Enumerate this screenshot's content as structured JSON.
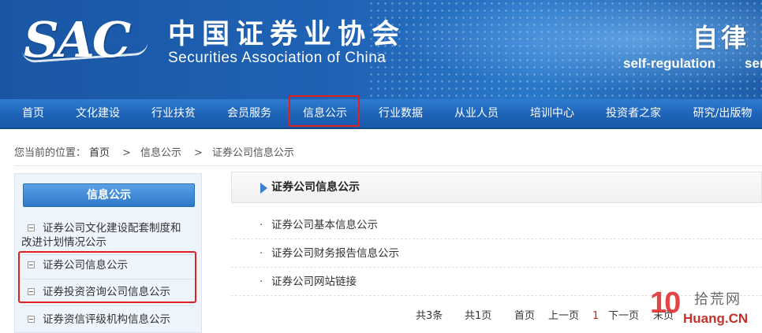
{
  "header": {
    "logo_text": "SAC",
    "org_name_cn": "中国证券业协会",
    "org_name_en": "Securities Association of China",
    "slogan_cn": "自律",
    "slogan_en": "self-regulation",
    "slogan_en_2": "ser"
  },
  "nav": {
    "items": [
      {
        "label": "首页"
      },
      {
        "label": "文化建设"
      },
      {
        "label": "行业扶贫"
      },
      {
        "label": "会员服务"
      },
      {
        "label": "信息公示"
      },
      {
        "label": "行业数据"
      },
      {
        "label": "从业人员"
      },
      {
        "label": "培训中心"
      },
      {
        "label": "投资者之家"
      },
      {
        "label": "研究/出版物"
      }
    ],
    "active_index": 4
  },
  "breadcrumb": {
    "prefix": "您当前的位置：",
    "items": [
      "首页",
      "信息公示",
      "证券公司信息公示"
    ],
    "separator": ">"
  },
  "sidebar": {
    "title": "信息公示",
    "items": [
      {
        "label_line1": "证券公司文化建设配套制度和",
        "label_line2": "改进计划情况公示"
      },
      {
        "label": "证券公司信息公示"
      },
      {
        "label": "证券投资咨询公司信息公示"
      },
      {
        "label": "证券资信评级机构信息公示"
      }
    ]
  },
  "main": {
    "section_title": "证券公司信息公示",
    "bullet": "·",
    "links": [
      {
        "label": "证券公司基本信息公示"
      },
      {
        "label": "证券公司财务报告信息公示"
      },
      {
        "label": "证券公司网站链接"
      }
    ]
  },
  "pager": {
    "total_records": "共3条",
    "total_pages": "共1页",
    "first": "首页",
    "prev": "上一页",
    "current": "1",
    "next": "下一页",
    "last": "末页"
  },
  "watermark": {
    "number": "10",
    "name_cn": "拾荒网",
    "domain": "Huang.CN"
  },
  "colors": {
    "header_blue": "#1f63b6",
    "nav_blue": "#1d63b7",
    "highlight_red": "#e02020",
    "sidebar_bg": "#eef4fb",
    "current_page": "#dd2222"
  }
}
